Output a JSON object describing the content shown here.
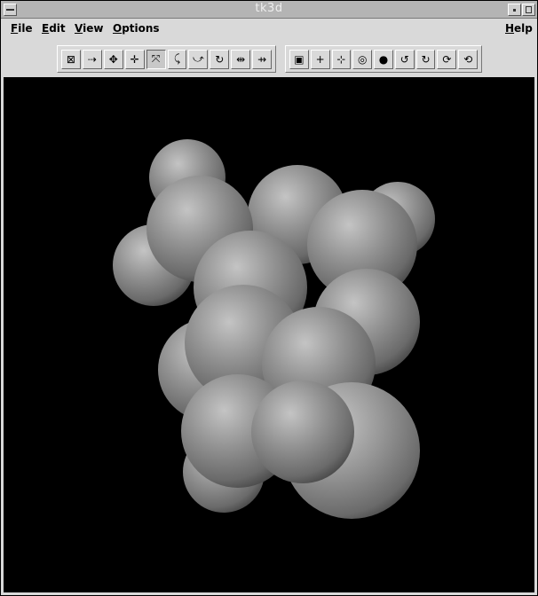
{
  "window": {
    "title": "tk3d"
  },
  "menu": {
    "file": "File",
    "edit": "Edit",
    "view": "View",
    "options": "Options",
    "help": "Help"
  },
  "toolbar_left": [
    {
      "icon": "frame-icon",
      "glyph": "⊠"
    },
    {
      "icon": "translate-x-icon",
      "glyph": "⇢"
    },
    {
      "icon": "move-xy-icon",
      "glyph": "✥"
    },
    {
      "icon": "move-xyz-icon",
      "glyph": "✛"
    },
    {
      "icon": "rotate-free-icon",
      "glyph": "⤧",
      "active": true
    },
    {
      "icon": "rotate-y-icon",
      "glyph": "⤹"
    },
    {
      "icon": "rotate-x-icon",
      "glyph": "⤻"
    },
    {
      "icon": "rotate-z-icon",
      "glyph": "↻"
    },
    {
      "icon": "scale-in-icon",
      "glyph": "⇹"
    },
    {
      "icon": "scale-out-icon",
      "glyph": "⇸"
    }
  ],
  "toolbar_right": [
    {
      "icon": "depth-cue-icon",
      "glyph": "▣"
    },
    {
      "icon": "center-icon",
      "glyph": "+"
    },
    {
      "icon": "fit-view-icon",
      "glyph": "⊹"
    },
    {
      "icon": "wireframe-icon",
      "glyph": "◎"
    },
    {
      "icon": "solid-icon",
      "glyph": "●"
    },
    {
      "icon": "spin-left-icon",
      "glyph": "↺"
    },
    {
      "icon": "spin-right-icon",
      "glyph": "↻"
    },
    {
      "icon": "spin-up-icon",
      "glyph": "⟳"
    },
    {
      "icon": "spin-down-icon",
      "glyph": "⟲"
    }
  ],
  "colors": {
    "background": "#000000",
    "atom": "#8a8a8a"
  }
}
